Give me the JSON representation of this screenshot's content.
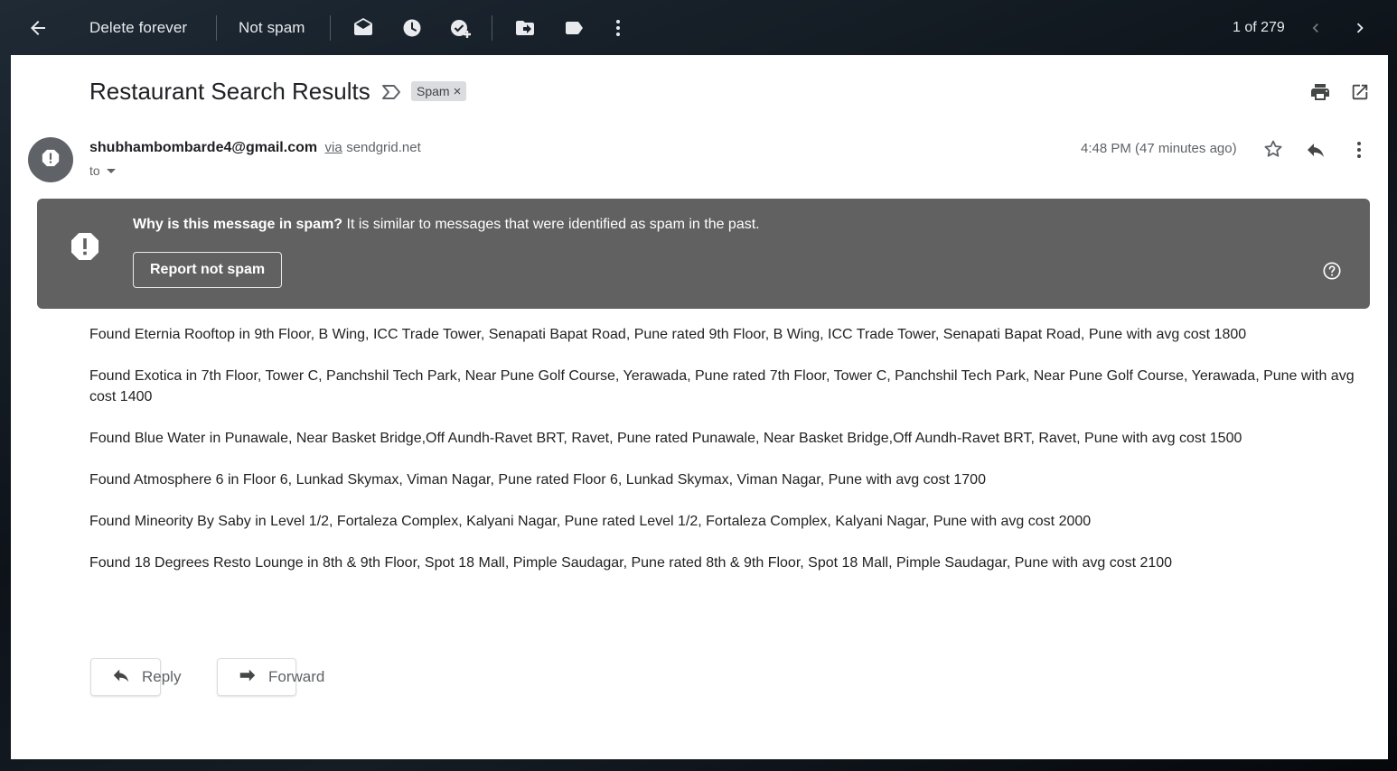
{
  "toolbar": {
    "back_icon": "arrow-back-icon",
    "delete_forever_label": "Delete forever",
    "not_spam_label": "Not spam",
    "icons": [
      "mark-unread-icon",
      "snooze-icon",
      "add-task-icon",
      "move-to-icon",
      "label-icon",
      "more-vert-icon"
    ],
    "pager_text": "1 of 279"
  },
  "message": {
    "subject": "Restaurant Search Results",
    "label_chip": "Spam",
    "label_chip_remove": "×",
    "sender_email": "shubhambombarde4@gmail.com",
    "via_label": "via",
    "via_domain": "sendgrid.net",
    "to_label": "to",
    "time": "4:48 PM (47 minutes ago)"
  },
  "spam_banner": {
    "why_bold": "Why is this message in spam?",
    "why_text": " It is similar to messages that were identified as spam in the past.",
    "report_button": "Report not spam"
  },
  "body_paragraphs": [
    "Found Eternia Rooftop in 9th Floor, B Wing, ICC Trade Tower, Senapati Bapat Road, Pune rated 9th Floor, B Wing, ICC Trade Tower, Senapati Bapat Road, Pune with avg cost 1800",
    "Found Exotica in 7th Floor, Tower C, Panchshil Tech Park, Near Pune Golf Course, Yerawada, Pune rated 7th Floor, Tower C, Panchshil Tech Park, Near Pune Golf Course, Yerawada, Pune with avg cost 1400",
    "Found Blue Water in Punawale, Near Basket Bridge,Off Aundh-Ravet BRT, Ravet, Pune rated Punawale, Near Basket Bridge,Off Aundh-Ravet BRT, Ravet, Pune with avg cost 1500",
    "Found Atmosphere 6 in Floor 6, Lunkad Skymax, Viman Nagar, Pune rated Floor 6, Lunkad Skymax, Viman Nagar, Pune with avg cost 1700",
    "Found Mineority By Saby in Level 1/2, Fortaleza Complex, Kalyani Nagar, Pune rated Level 1/2, Fortaleza Complex, Kalyani Nagar, Pune with avg cost 2000",
    "Found 18 Degrees Resto Lounge in 8th & 9th Floor, Spot 18 Mall, Pimple Saudagar, Pune rated 8th & 9th Floor, Spot 18 Mall, Pimple Saudagar, Pune with avg cost 2100"
  ],
  "actions": {
    "reply_label": "Reply",
    "forward_label": "Forward"
  }
}
